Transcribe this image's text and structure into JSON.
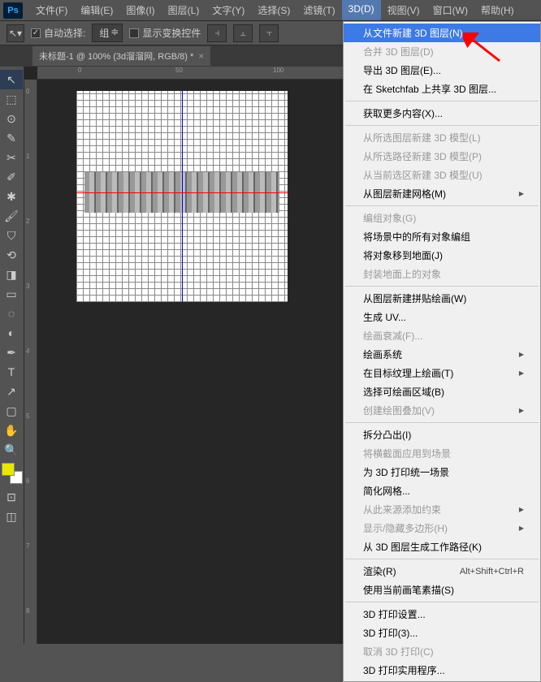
{
  "app_logo": "Ps",
  "menubar": [
    {
      "label": "文件(F)"
    },
    {
      "label": "编辑(E)"
    },
    {
      "label": "图像(I)"
    },
    {
      "label": "图层(L)"
    },
    {
      "label": "文字(Y)"
    },
    {
      "label": "选择(S)"
    },
    {
      "label": "滤镜(T)"
    },
    {
      "label": "3D(D)",
      "active": true
    },
    {
      "label": "视图(V)"
    },
    {
      "label": "窗口(W)"
    },
    {
      "label": "帮助(H)"
    }
  ],
  "options_bar": {
    "auto_select_label": "自动选择:",
    "auto_select_checked": true,
    "group_dropdown": "组",
    "show_transform_label": "显示变换控件",
    "show_transform_checked": false
  },
  "doc_tab": {
    "title": "未标题-1 @ 100% (3d溜溜网, RGB/8) *",
    "close": "×"
  },
  "tools": [
    {
      "icon": "↖",
      "name": "move-tool",
      "active": true
    },
    {
      "icon": "⬚",
      "name": "marquee-tool"
    },
    {
      "icon": "⊙",
      "name": "lasso-tool"
    },
    {
      "icon": "✎",
      "name": "quick-select-tool"
    },
    {
      "icon": "✂",
      "name": "crop-tool"
    },
    {
      "icon": "✐",
      "name": "eyedropper-tool"
    },
    {
      "icon": "✱",
      "name": "spot-heal-tool"
    },
    {
      "icon": "🖌",
      "name": "brush-tool"
    },
    {
      "icon": "⛉",
      "name": "stamp-tool"
    },
    {
      "icon": "⟲",
      "name": "history-brush-tool"
    },
    {
      "icon": "◨",
      "name": "eraser-tool"
    },
    {
      "icon": "▭",
      "name": "gradient-tool"
    },
    {
      "icon": "◌",
      "name": "blur-tool"
    },
    {
      "icon": "◐",
      "name": "dodge-tool"
    },
    {
      "icon": "✒",
      "name": "pen-tool"
    },
    {
      "icon": "T",
      "name": "type-tool"
    },
    {
      "icon": "↗",
      "name": "path-select-tool"
    },
    {
      "icon": "▢",
      "name": "rectangle-tool"
    },
    {
      "icon": "✋",
      "name": "hand-tool"
    },
    {
      "icon": "🔍",
      "name": "zoom-tool"
    }
  ],
  "extra_tools": [
    {
      "icon": "⊡",
      "name": "edit-toolbar"
    },
    {
      "icon": "◫",
      "name": "quick-mask"
    }
  ],
  "dropdown_3d": [
    {
      "label": "从文件新建 3D 图层(N)...",
      "highlighted": true
    },
    {
      "label": "合并 3D 图层(D)",
      "disabled": true
    },
    {
      "label": "导出 3D 图层(E)..."
    },
    {
      "label": "在 Sketchfab 上共享 3D 图层..."
    },
    {
      "sep": true
    },
    {
      "label": "获取更多内容(X)..."
    },
    {
      "sep": true
    },
    {
      "label": "从所选图层新建 3D 模型(L)",
      "disabled": true
    },
    {
      "label": "从所选路径新建 3D 模型(P)",
      "disabled": true
    },
    {
      "label": "从当前选区新建 3D 模型(U)",
      "disabled": true
    },
    {
      "label": "从图层新建网格(M)",
      "sub": true
    },
    {
      "sep": true
    },
    {
      "label": "编组对象(G)",
      "disabled": true
    },
    {
      "label": "将场景中的所有对象编组"
    },
    {
      "label": "将对象移到地面(J)"
    },
    {
      "label": "封装地面上的对象",
      "disabled": true
    },
    {
      "sep": true
    },
    {
      "label": "从图层新建拼贴绘画(W)"
    },
    {
      "label": "生成 UV..."
    },
    {
      "label": "绘画衰减(F)...",
      "disabled": true
    },
    {
      "label": "绘画系统",
      "sub": true
    },
    {
      "label": "在目标纹理上绘画(T)",
      "sub": true
    },
    {
      "label": "选择可绘画区域(B)"
    },
    {
      "label": "创建绘图叠加(V)",
      "sub": true,
      "disabled": true
    },
    {
      "sep": true
    },
    {
      "label": "拆分凸出(I)"
    },
    {
      "label": "将横截面应用到场景",
      "disabled": true
    },
    {
      "label": "为 3D 打印统一场景"
    },
    {
      "label": "简化网格..."
    },
    {
      "label": "从此来源添加约束",
      "sub": true,
      "disabled": true
    },
    {
      "label": "显示/隐藏多边形(H)",
      "sub": true,
      "disabled": true
    },
    {
      "label": "从 3D 图层生成工作路径(K)"
    },
    {
      "sep": true
    },
    {
      "label": "渲染(R)",
      "shortcut": "Alt+Shift+Ctrl+R"
    },
    {
      "label": "使用当前画笔素描(S)"
    },
    {
      "sep": true
    },
    {
      "label": "3D 打印设置..."
    },
    {
      "label": "3D 打印(3)..."
    },
    {
      "label": "取消 3D 打印(C)",
      "disabled": true
    },
    {
      "label": "3D 打印实用程序..."
    }
  ],
  "ruler_marks_h": [
    "0",
    "50",
    "100"
  ],
  "ruler_marks_v": [
    "0",
    "1",
    "2",
    "3",
    "4",
    "5",
    "6",
    "7",
    "8"
  ]
}
